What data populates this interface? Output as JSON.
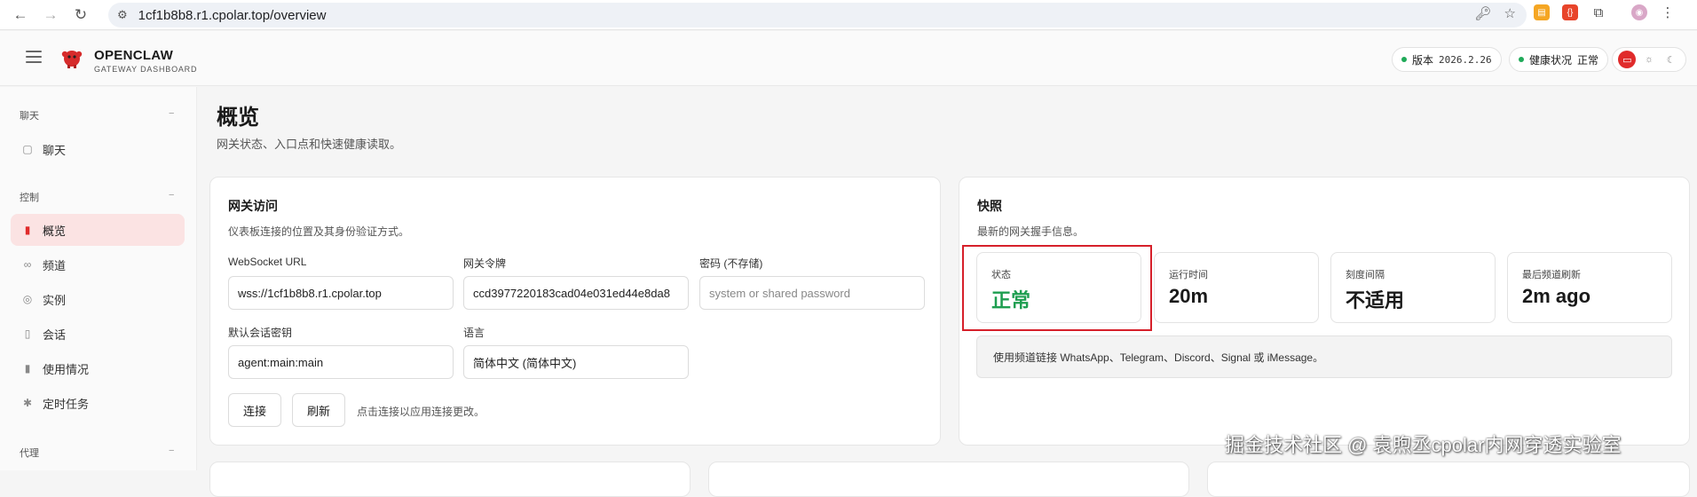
{
  "browser": {
    "url": "1cf1b8b8.r1.cpolar.top/overview"
  },
  "header": {
    "brand_title": "OPENCLAW",
    "brand_subtitle": "GATEWAY DASHBOARD",
    "version_label": "版本",
    "version_value": "2026.2.26",
    "health_label": "健康状况",
    "health_value": "正常"
  },
  "sidebar": {
    "sections": [
      {
        "label": "聊天",
        "dash": "−"
      },
      {
        "label": "控制",
        "dash": "−"
      },
      {
        "label": "代理",
        "dash": "−"
      }
    ],
    "items": [
      {
        "label": "聊天",
        "icon": "chat-icon"
      },
      {
        "label": "概览",
        "icon": "bar-chart-icon"
      },
      {
        "label": "频道",
        "icon": "link-icon"
      },
      {
        "label": "实例",
        "icon": "broadcast-icon"
      },
      {
        "label": "会话",
        "icon": "document-icon"
      },
      {
        "label": "使用情况",
        "icon": "bar-chart-icon"
      },
      {
        "label": "定时任务",
        "icon": "loader-icon"
      }
    ]
  },
  "page": {
    "title": "概览",
    "subtitle": "网关状态、入口点和快速健康读取。"
  },
  "gateway_card": {
    "title": "网关访问",
    "subtitle": "仪表板连接的位置及其身份验证方式。",
    "ws_label": "WebSocket URL",
    "ws_value": "wss://1cf1b8b8.r1.cpolar.top",
    "token_label": "网关令牌",
    "token_value": "ccd3977220183cad04e031ed44e8da8",
    "password_label": "密码 (不存储)",
    "password_placeholder": "system or shared password",
    "session_label": "默认会话密钥",
    "session_value": "agent:main:main",
    "language_label": "语言",
    "language_value": "简体中文 (简体中文)",
    "connect_button": "连接",
    "refresh_button": "刷新",
    "hint": "点击连接以应用连接更改。"
  },
  "snapshot_card": {
    "title": "快照",
    "subtitle": "最新的网关握手信息。",
    "stats": [
      {
        "label": "状态",
        "value": "正常"
      },
      {
        "label": "运行时间",
        "value": "20m"
      },
      {
        "label": "刻度间隔",
        "value": "不适用"
      },
      {
        "label": "最后频道刷新",
        "value": "2m ago"
      }
    ],
    "info": "使用频道链接 WhatsApp、Telegram、Discord、Signal 或 iMessage。"
  },
  "watermark": "掘金技术社区 @ 袁煦丞cpolar内网穿透实验室",
  "colors": {
    "accent": "#e02b2b",
    "ok": "#1e9e50",
    "highlight_box": "#d6202a"
  }
}
